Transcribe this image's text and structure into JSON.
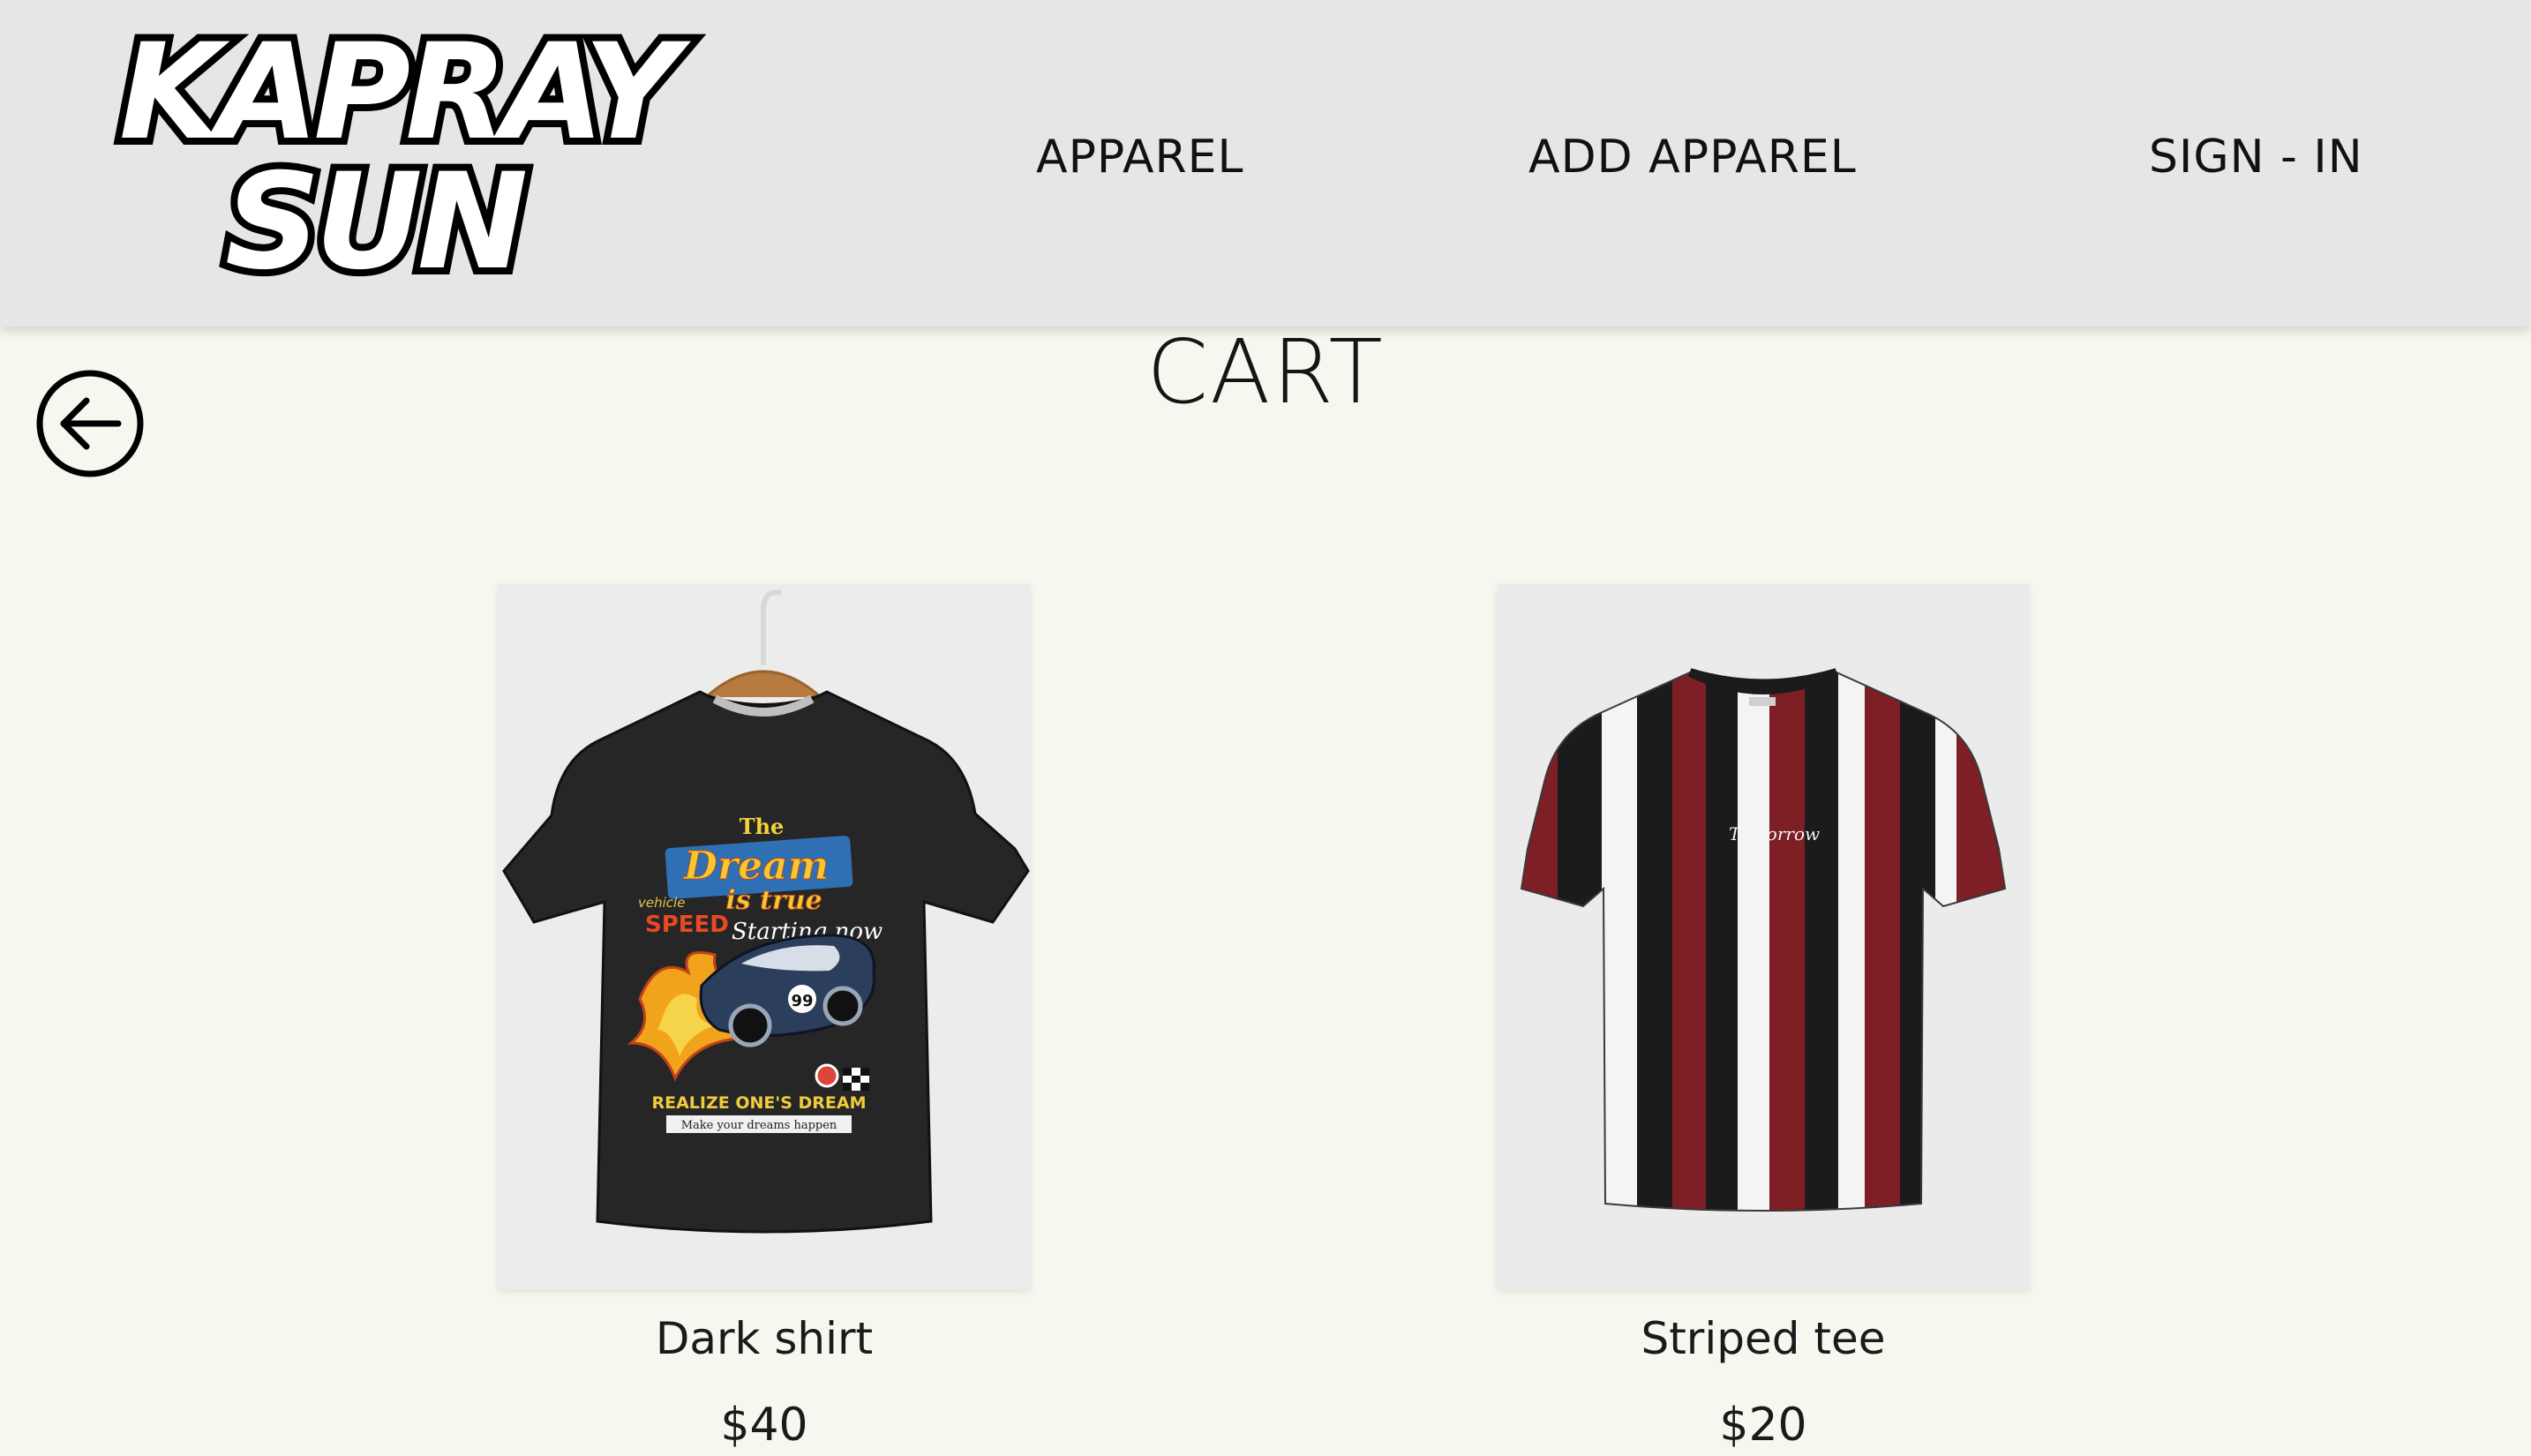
{
  "header": {
    "logo": {
      "line1": "KAPRAY",
      "line2": "SUN"
    },
    "nav": [
      {
        "label": "APPAREL"
      },
      {
        "label": "ADD APPAREL"
      },
      {
        "label": "SIGN - IN"
      }
    ]
  },
  "page": {
    "title": "CART",
    "back_icon": "arrow-left-circle-icon"
  },
  "products": [
    {
      "name": "Dark shirt",
      "price": "$40",
      "print": {
        "line1": "The",
        "line2": "Dream",
        "line3": "is true",
        "line4": "Starting now",
        "badge": "vehicle",
        "badge2": "SPEED",
        "number": "99",
        "line5": "REALIZE ONE'S DREAM",
        "line6": "Make your dreams happen"
      }
    },
    {
      "name": "Striped tee",
      "price": "$20",
      "print": {
        "signature": "Tomorrow"
      }
    }
  ],
  "colors": {
    "background": "#f7f6ef",
    "header": "#e6e6e6",
    "stripe_red": "#7e1e25",
    "stripe_black": "#1b1b1d",
    "stripe_white": "#f4f4f4"
  }
}
